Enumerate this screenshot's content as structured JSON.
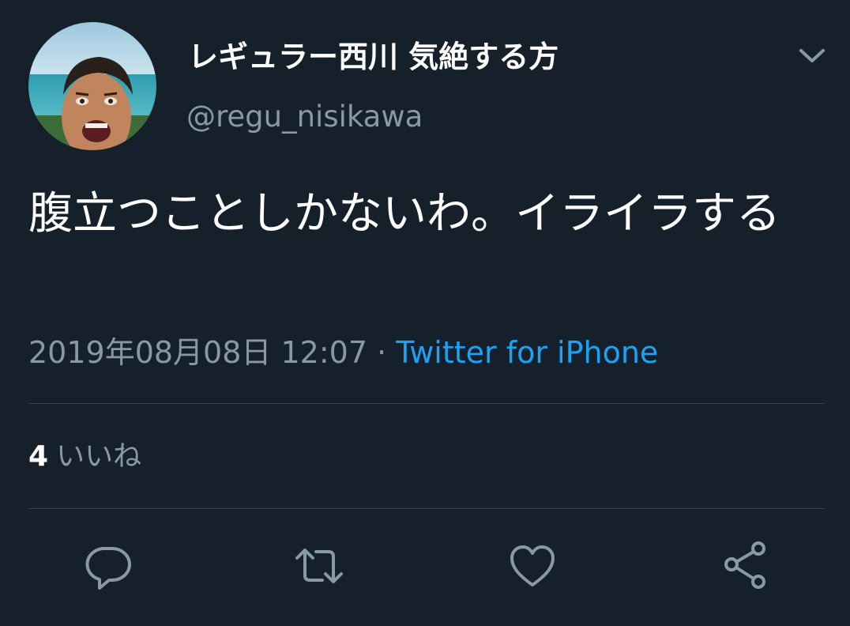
{
  "user": {
    "display_name": "レギュラー西川 気絶する方",
    "handle": "@regu_nisikawa"
  },
  "tweet": {
    "text": "腹立つことしかないわ。イライラする",
    "timestamp": "2019年08月08日 12:07",
    "separator": " · ",
    "source": "Twitter for iPhone"
  },
  "stats": {
    "likes_count": "4",
    "likes_label": "いいね"
  },
  "icons": {
    "menu": "chevron-down-icon",
    "reply": "reply-icon",
    "retweet": "retweet-icon",
    "like": "heart-icon",
    "share": "share-icon"
  },
  "colors": {
    "background": "#15202b",
    "primary_text": "#ffffff",
    "secondary_text": "#8899a6",
    "link": "#1da1f2",
    "divider": "#38444d"
  }
}
